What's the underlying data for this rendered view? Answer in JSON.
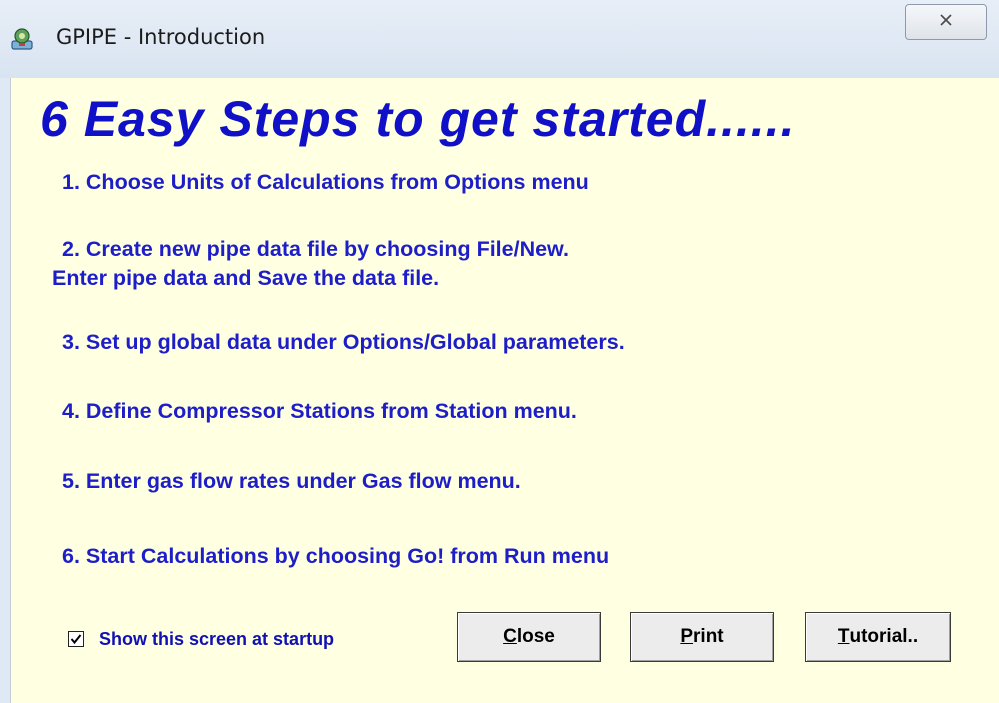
{
  "window": {
    "title": "GPIPE - Introduction",
    "close_glyph": "✕"
  },
  "heading": "6  Easy Steps to get started......",
  "steps": [
    {
      "line1": "1.  Choose Units of Calculations from Options  menu"
    },
    {
      "line1": "2.  Create new  pipe data file by choosing File/New.",
      "line2": "Enter pipe data  and   Save the data file."
    },
    {
      "line1": "3.  Set up global  data under Options/Global parameters."
    },
    {
      "line1": "4.  Define Compressor Stations from  Station  menu."
    },
    {
      "line1": "5. Enter gas flow rates under Gas flow menu."
    },
    {
      "line1": "6. Start Calculations by choosing  Go!  from Run menu"
    }
  ],
  "startup_checkbox": {
    "label": "Show this screen at startup",
    "checked": true
  },
  "buttons": {
    "close": {
      "mnemonic": "C",
      "rest": "lose"
    },
    "print": {
      "mnemonic": "P",
      "rest": "rint"
    },
    "tutorial": {
      "mnemonic": "T",
      "rest": "utorial.."
    }
  },
  "colors": {
    "background": "#ffffe1",
    "text_blue": "#1e1ec8"
  },
  "icons": {
    "app": "gpipe-app-icon",
    "close": "close-icon",
    "check": "checkmark-icon"
  }
}
